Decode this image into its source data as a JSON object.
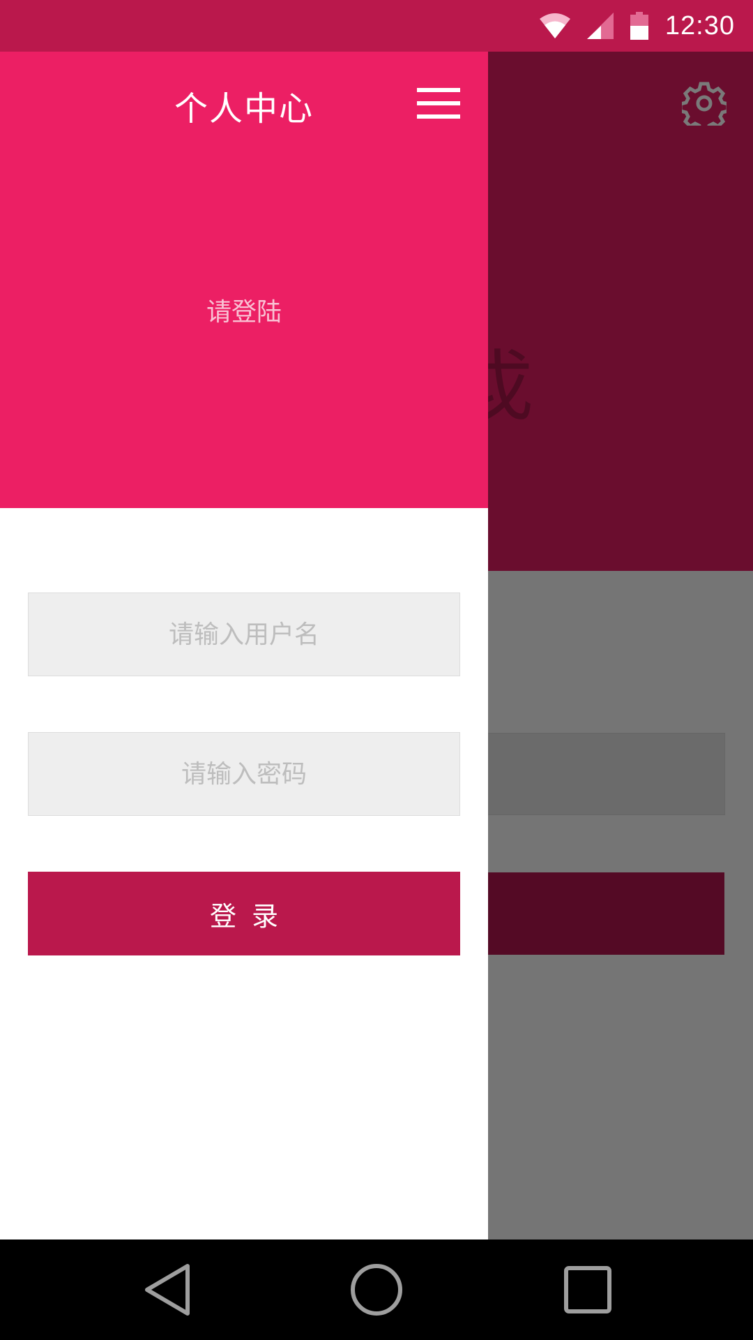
{
  "status_bar": {
    "time": "12:30",
    "icons": [
      "wifi-icon",
      "cell-signal-icon",
      "battery-icon"
    ]
  },
  "background_app": {
    "header_color": "#6A0D2E",
    "icon": "gear-icon",
    "partial_text": "戉"
  },
  "drawer": {
    "title": "个人中心",
    "menu_icon": "hamburger-menu-icon",
    "login_prompt": "请登陆",
    "username_placeholder": "请输入用户名",
    "password_placeholder": "请输入密码",
    "login_label": "登录",
    "accent_color": "#EC1F64",
    "button_color": "#BA184C"
  },
  "nav_bar": {
    "icons": [
      "back-icon",
      "home-icon",
      "recent-apps-icon"
    ]
  }
}
